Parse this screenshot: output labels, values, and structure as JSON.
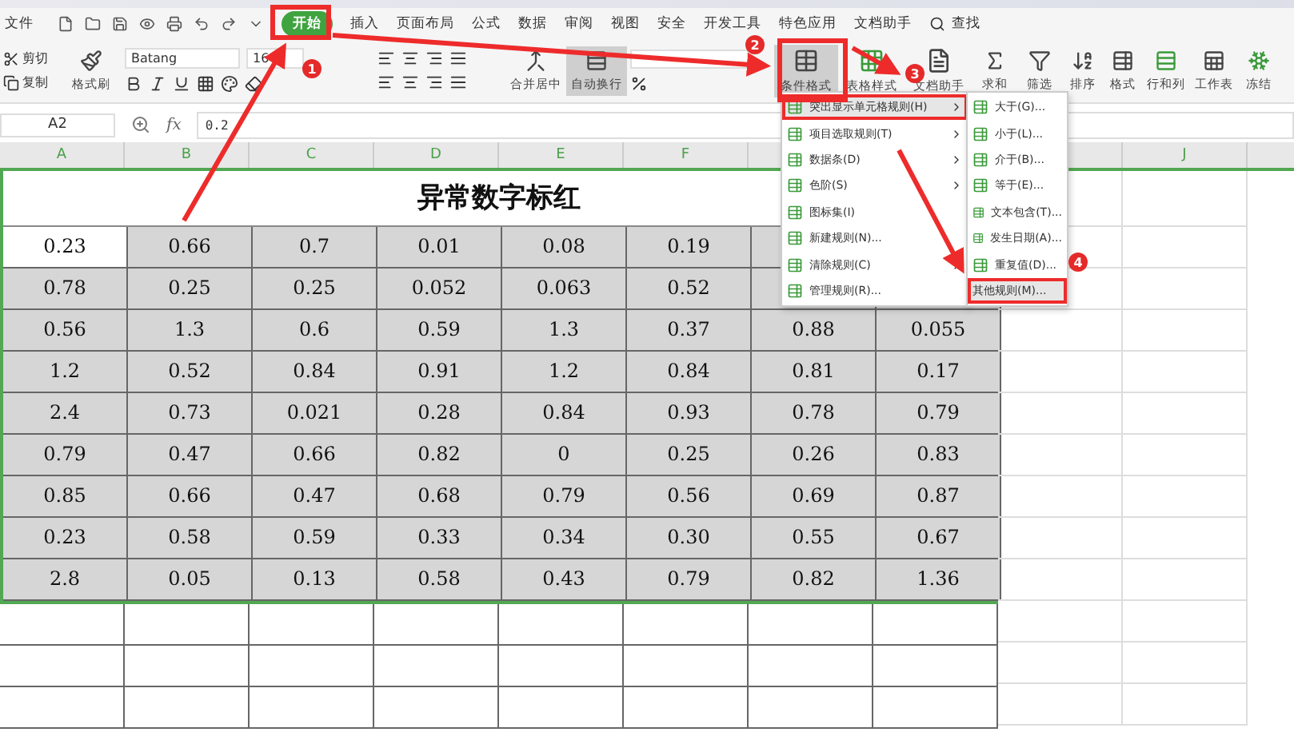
{
  "menu_bar": {
    "file": "文件",
    "tabs": [
      {
        "label": "开始",
        "selected": true
      },
      {
        "label": "插入",
        "selected": false
      },
      {
        "label": "页面布局",
        "selected": false
      },
      {
        "label": "公式",
        "selected": false
      },
      {
        "label": "数据",
        "selected": false
      },
      {
        "label": "审阅",
        "selected": false
      },
      {
        "label": "视图",
        "selected": false
      },
      {
        "label": "安全",
        "selected": false
      },
      {
        "label": "开发工具",
        "selected": false
      },
      {
        "label": "特色应用",
        "selected": false
      },
      {
        "label": "文档助手",
        "selected": false
      }
    ],
    "search": "查找"
  },
  "ribbon": {
    "cut": "剪切",
    "copy": "复制",
    "format_painter": "格式刷",
    "font": {
      "name": "Batang",
      "size": "16"
    },
    "merge": "合并居中",
    "wrap": {
      "label": "自动换行",
      "selected": true
    },
    "big_buttons": [
      {
        "label": "条件格式",
        "selected": true,
        "kind": "table"
      },
      {
        "label": "表格样式",
        "selected": false,
        "kind": "style"
      },
      {
        "label": "文档助手",
        "selected": false,
        "kind": "doc"
      }
    ],
    "tools": [
      {
        "label": "求和",
        "kind": "sum"
      },
      {
        "label": "筛选",
        "kind": "filter"
      },
      {
        "label": "排序",
        "kind": "sort"
      },
      {
        "label": "格式",
        "kind": "format"
      },
      {
        "label": "行和列",
        "kind": "rows"
      },
      {
        "label": "工作表",
        "kind": "sheet"
      },
      {
        "label": "冻结",
        "kind": "freeze"
      }
    ]
  },
  "formula_bar": {
    "cell": "A2",
    "fx": "fx",
    "value": "0.2"
  },
  "sheet": {
    "columns": [
      "A",
      "B",
      "C",
      "D",
      "E",
      "F",
      null,
      null,
      null,
      "J"
    ],
    "title": "异常数字标红",
    "rows": [
      [
        {
          "text": "0.23",
          "selected": true
        },
        {
          "text": "0.66",
          "selected": false
        },
        {
          "text": "0.7",
          "selected": false
        },
        {
          "text": "0.01",
          "selected": false
        },
        {
          "text": "0.08",
          "selected": false
        },
        {
          "text": "0.19",
          "selected": false
        },
        null,
        null
      ],
      [
        {
          "text": "0.78",
          "selected": false
        },
        {
          "text": "0.25",
          "selected": false
        },
        {
          "text": "0.25",
          "selected": false
        },
        {
          "text": "0.052",
          "selected": false
        },
        {
          "text": "0.063",
          "selected": false
        },
        {
          "text": "0.52",
          "selected": false
        },
        null,
        null
      ],
      [
        {
          "text": "0.56",
          "selected": false
        },
        {
          "text": "1.3",
          "selected": false
        },
        {
          "text": "0.6",
          "selected": false
        },
        {
          "text": "0.59",
          "selected": false
        },
        {
          "text": "1.3",
          "selected": false
        },
        {
          "text": "0.37",
          "selected": false
        },
        {
          "text": "0.88",
          "selected": false
        },
        {
          "text": "0.055",
          "selected": false
        }
      ],
      [
        {
          "text": "1.2",
          "selected": false
        },
        {
          "text": "0.52",
          "selected": false
        },
        {
          "text": "0.84",
          "selected": false
        },
        {
          "text": "0.91",
          "selected": false
        },
        {
          "text": "1.2",
          "selected": false
        },
        {
          "text": "0.84",
          "selected": false
        },
        {
          "text": "0.81",
          "selected": false
        },
        {
          "text": "0.17",
          "selected": false
        }
      ],
      [
        {
          "text": "2.4",
          "selected": false
        },
        {
          "text": "0.73",
          "selected": false
        },
        {
          "text": "0.021",
          "selected": false
        },
        {
          "text": "0.28",
          "selected": false
        },
        {
          "text": "0.84",
          "selected": false
        },
        {
          "text": "0.93",
          "selected": false
        },
        {
          "text": "0.78",
          "selected": false
        },
        {
          "text": "0.79",
          "selected": false
        }
      ],
      [
        {
          "text": "0.79",
          "selected": false
        },
        {
          "text": "0.47",
          "selected": false
        },
        {
          "text": "0.66",
          "selected": false
        },
        {
          "text": "0.82",
          "selected": false
        },
        {
          "text": "0",
          "selected": false
        },
        {
          "text": "0.25",
          "selected": false
        },
        {
          "text": "0.26",
          "selected": false
        },
        {
          "text": "0.83",
          "selected": false
        }
      ],
      [
        {
          "text": "0.85",
          "selected": false
        },
        {
          "text": "0.66",
          "selected": false
        },
        {
          "text": "0.47",
          "selected": false
        },
        {
          "text": "0.68",
          "selected": false
        },
        {
          "text": "0.79",
          "selected": false
        },
        {
          "text": "0.56",
          "selected": false
        },
        {
          "text": "0.69",
          "selected": false
        },
        {
          "text": "0.87",
          "selected": false
        }
      ],
      [
        {
          "text": "0.23",
          "selected": false
        },
        {
          "text": "0.58",
          "selected": false
        },
        {
          "text": "0.59",
          "selected": false
        },
        {
          "text": "0.33",
          "selected": false
        },
        {
          "text": "0.34",
          "selected": false
        },
        {
          "text": "0.30",
          "selected": false
        },
        {
          "text": "0.55",
          "selected": false
        },
        {
          "text": "0.67",
          "selected": false
        }
      ],
      [
        {
          "text": "2.8",
          "selected": false
        },
        {
          "text": "0.05",
          "selected": false
        },
        {
          "text": "0.13",
          "selected": false
        },
        {
          "text": "0.58",
          "selected": false
        },
        {
          "text": "0.43",
          "selected": false
        },
        {
          "text": "0.79",
          "selected": false
        },
        {
          "text": "0.82",
          "selected": false
        },
        {
          "text": "1.36",
          "selected": false
        }
      ]
    ]
  },
  "menu": {
    "items": [
      {
        "label": "突出显示单元格规则(H)",
        "selected": true,
        "submenu": true
      },
      {
        "label": "项目选取规则(T)",
        "selected": false,
        "submenu": true
      },
      {
        "label": "数据条(D)",
        "selected": false,
        "submenu": true
      },
      {
        "label": "色阶(S)",
        "selected": false,
        "submenu": true
      },
      {
        "label": "图标集(I)",
        "selected": false,
        "submenu": false
      },
      {
        "label": "新建规则(N)...",
        "selected": false,
        "submenu": false
      },
      {
        "label": "清除规则(C)",
        "selected": false,
        "submenu": true
      },
      {
        "label": "管理规则(R)...",
        "selected": false,
        "submenu": false
      }
    ]
  },
  "submenu": {
    "items": [
      {
        "label": "大于(G)...",
        "selected": false
      },
      {
        "label": "小于(L)...",
        "selected": false
      },
      {
        "label": "介于(B)...",
        "selected": false
      },
      {
        "label": "等于(E)...",
        "selected": false
      },
      {
        "label": "文本包含(T)...",
        "selected": false
      },
      {
        "label": "发生日期(A)...",
        "selected": false
      },
      {
        "label": "重复值(D)...",
        "selected": false
      },
      {
        "label": "其他规则(M)...",
        "selected": true
      }
    ]
  },
  "annotations": {
    "badges": [
      "1",
      "2",
      "3",
      "4"
    ]
  }
}
